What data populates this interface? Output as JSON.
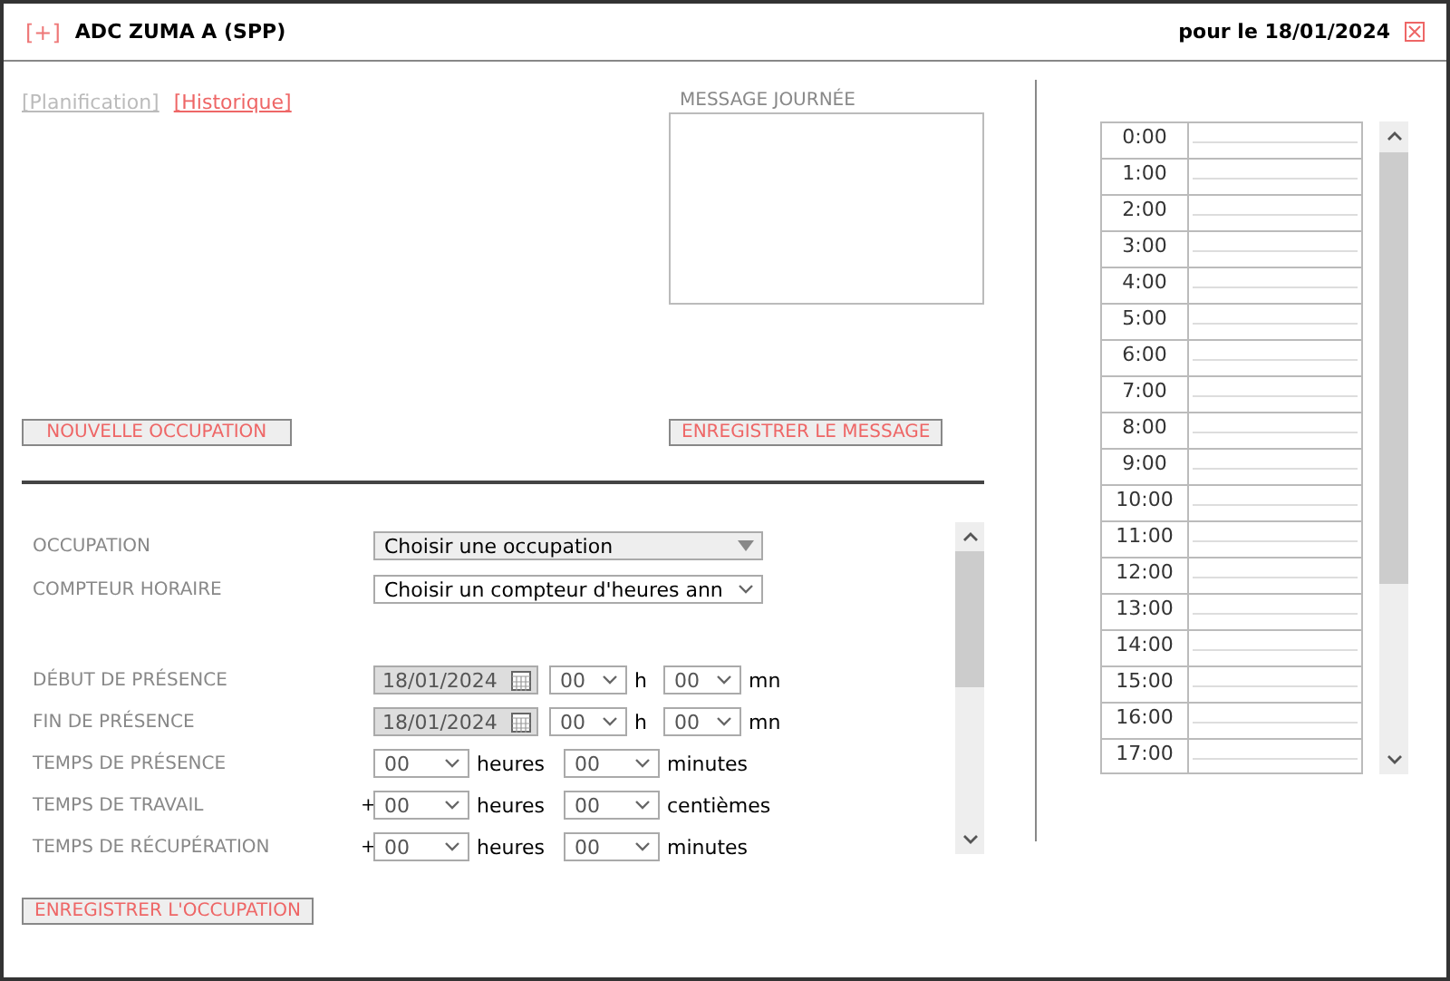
{
  "header": {
    "toggle": "[+]",
    "title": "ADC ZUMA A (SPP)",
    "date": "pour le 18/01/2024"
  },
  "links": [
    {
      "label": "[Planification]",
      "disabled": true
    },
    {
      "label": "[Historique]",
      "disabled": false
    }
  ],
  "message": {
    "label": "MESSAGE JOURNÉE",
    "save_button": "ENREGISTRER LE MESSAGE"
  },
  "new_button": "NOUVELLE OCCUPATION",
  "form": {
    "sections": [
      [
        {
          "kind": "combo",
          "label": "OCCUPATION",
          "value": "Choisir une occupation"
        },
        {
          "kind": "select",
          "label": "COMPTEUR HORAIRE",
          "value": "Choisir un compteur d'heures ann"
        }
      ],
      [
        {
          "kind": "datetime",
          "label": "DÉBUT DE PRÉSENCE",
          "date": "18/01/2024",
          "hours": "00",
          "hours_unit": "h",
          "minutes": "00",
          "minutes_unit": "mn"
        },
        {
          "kind": "datetime",
          "label": "FIN DE PRÉSENCE",
          "date": "18/01/2024",
          "hours": "00",
          "hours_unit": "h",
          "minutes": "00",
          "minutes_unit": "mn"
        },
        {
          "kind": "duration",
          "label": "TEMPS DE PRÉSENCE",
          "hours": "00",
          "hours_unit": "heures",
          "minutes": "00",
          "minutes_unit": "minutes"
        },
        {
          "kind": "duration",
          "label": "TEMPS DE TRAVAIL",
          "prefix": "+",
          "hours": "00",
          "hours_unit": "heures",
          "minutes": "00",
          "minutes_unit": "centièmes"
        },
        {
          "kind": "duration",
          "label": "TEMPS DE RÉCUPÉRATION",
          "prefix": "+",
          "hours": "00",
          "hours_unit": "heures",
          "minutes": "00",
          "minutes_unit": "minutes"
        }
      ]
    ]
  },
  "save_button": "ENREGISTRER L'OCCUPATION",
  "schedule": {
    "hours": [
      "0:00",
      "1:00",
      "2:00",
      "3:00",
      "4:00",
      "5:00",
      "6:00",
      "7:00",
      "8:00",
      "9:00",
      "10:00",
      "11:00",
      "12:00",
      "13:00",
      "14:00",
      "15:00",
      "16:00",
      "17:00"
    ]
  }
}
